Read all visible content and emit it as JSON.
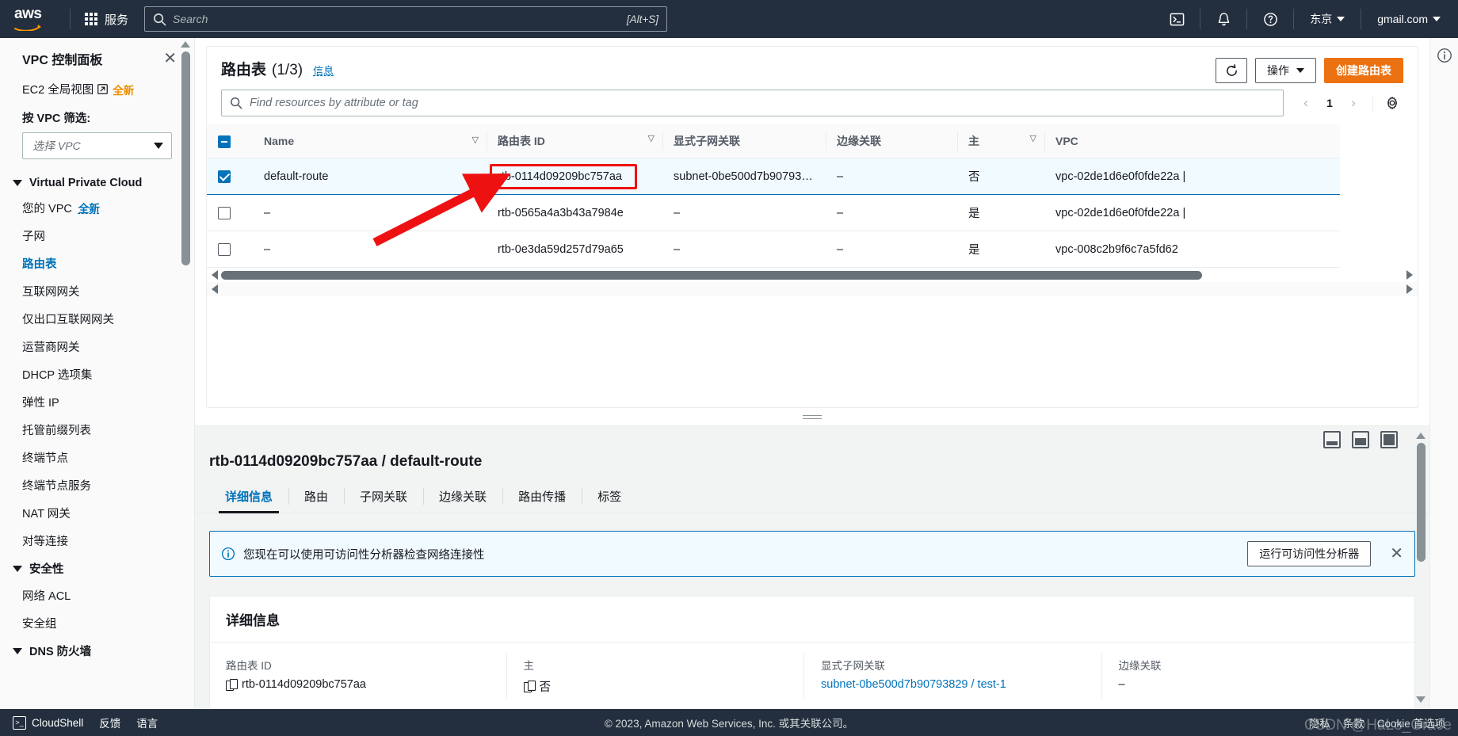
{
  "topnav": {
    "logo_text": "aws",
    "services_label": "服务",
    "search_placeholder": "Search",
    "search_value": "",
    "search_shortcut": "[Alt+S]",
    "cloudshell_icon": "cloudshell-icon",
    "bell_icon": "bell-notification-icon",
    "help_icon": "help-question-icon",
    "region_label": "东京",
    "account_label": "gmail.com"
  },
  "sidebar": {
    "title": "VPC 控制面板",
    "close_icon": "close-icon",
    "global_view": {
      "label": "EC2 全局视图",
      "external_icon": "external-link-icon",
      "badge": "全新"
    },
    "filter_label": "按 VPC 筛选:",
    "vpc_select_placeholder": "选择 VPC",
    "groups": [
      {
        "label": "Virtual Private Cloud",
        "items": [
          {
            "label": "您的 VPC",
            "badge": "全新",
            "active": false
          },
          {
            "label": "子网",
            "badge": "",
            "active": false
          },
          {
            "label": "路由表",
            "badge": "",
            "active": true
          },
          {
            "label": "互联网网关",
            "badge": "",
            "active": false
          },
          {
            "label": "仅出口互联网网关",
            "badge": "",
            "active": false
          },
          {
            "label": "运营商网关",
            "badge": "",
            "active": false
          },
          {
            "label": "DHCP 选项集",
            "badge": "",
            "active": false
          },
          {
            "label": "弹性 IP",
            "badge": "",
            "active": false
          },
          {
            "label": "托管前缀列表",
            "badge": "",
            "active": false
          },
          {
            "label": "终端节点",
            "badge": "",
            "active": false
          },
          {
            "label": "终端节点服务",
            "badge": "",
            "active": false
          },
          {
            "label": "NAT 网关",
            "badge": "",
            "active": false
          },
          {
            "label": "对等连接",
            "badge": "",
            "active": false
          }
        ]
      },
      {
        "label": "安全性",
        "items": [
          {
            "label": "网络 ACL",
            "badge": "",
            "active": false
          },
          {
            "label": "安全组",
            "badge": "",
            "active": false
          }
        ]
      },
      {
        "label": "DNS 防火墙",
        "items": []
      }
    ]
  },
  "list_panel": {
    "title": "路由表",
    "count": "(1/3)",
    "info_link": "信息",
    "refresh_icon": "refresh-icon",
    "actions_label": "操作",
    "create_label": "创建路由表",
    "search_placeholder": "Find resources by attribute or tag",
    "search_value": "",
    "page_number": "1",
    "prev_icon": "chevron-left-icon",
    "next_icon": "chevron-right-icon",
    "settings_icon": "gear-icon",
    "columns": [
      "Name",
      "路由表 ID",
      "显式子网关联",
      "边缘关联",
      "主",
      "VPC"
    ],
    "rows": [
      {
        "selected": true,
        "name": "default-route",
        "route_table_id": "rtb-0114d09209bc757aa",
        "subnet_assoc": "subnet-0be500d7b90793…",
        "edge_assoc": "–",
        "main": "否",
        "vpc": "vpc-02de1d6e0f0fde22a |"
      },
      {
        "selected": false,
        "name": "–",
        "route_table_id": "rtb-0565a4a3b43a7984e",
        "subnet_assoc": "–",
        "edge_assoc": "–",
        "main": "是",
        "vpc": "vpc-02de1d6e0f0fde22a |"
      },
      {
        "selected": false,
        "name": "–",
        "route_table_id": "rtb-0e3da59d257d79a65",
        "subnet_assoc": "–",
        "edge_assoc": "–",
        "main": "是",
        "vpc": "vpc-008c2b9f6c7a5fd62"
      }
    ]
  },
  "detail_panel": {
    "title": "rtb-0114d09209bc757aa / default-route",
    "tabs": [
      {
        "label": "详细信息",
        "active": true
      },
      {
        "label": "路由",
        "active": false
      },
      {
        "label": "子网关联",
        "active": false
      },
      {
        "label": "边缘关联",
        "active": false
      },
      {
        "label": "路由传播",
        "active": false
      },
      {
        "label": "标签",
        "active": false
      }
    ],
    "alert": {
      "icon": "info-circle-icon",
      "message": "您现在可以使用可访问性分析器检查网络连接性",
      "button": "运行可访问性分析器",
      "close_icon": "close-icon"
    },
    "card_title": "详细信息",
    "fields": [
      {
        "label": "路由表 ID",
        "value": "rtb-0114d09209bc757aa",
        "copyable": true,
        "link": false
      },
      {
        "label": "主",
        "value": "否",
        "copyable": true,
        "link": false
      },
      {
        "label": "显式子网关联",
        "value": "subnet-0be500d7b90793829 / test-1",
        "copyable": false,
        "link": true
      },
      {
        "label": "边缘关联",
        "value": "–",
        "copyable": false,
        "link": false
      }
    ],
    "size_icons": [
      "panel-size-small-icon",
      "panel-size-medium-icon",
      "panel-size-large-icon"
    ]
  },
  "right_rail": {
    "info_icon": "info-circle-icon"
  },
  "footer": {
    "cloudshell": "CloudShell",
    "feedback": "反馈",
    "language": "语言",
    "copyright": "© 2023, Amazon Web Services, Inc. 或其关联公司。",
    "links": [
      "隐私",
      "条款",
      "Cookie 首选项"
    ],
    "watermark": "CSDN @HaLo_Grace"
  },
  "annotation": {
    "highlight_color": "#ee1111",
    "target": "rtb-0114d09209bc757aa"
  }
}
